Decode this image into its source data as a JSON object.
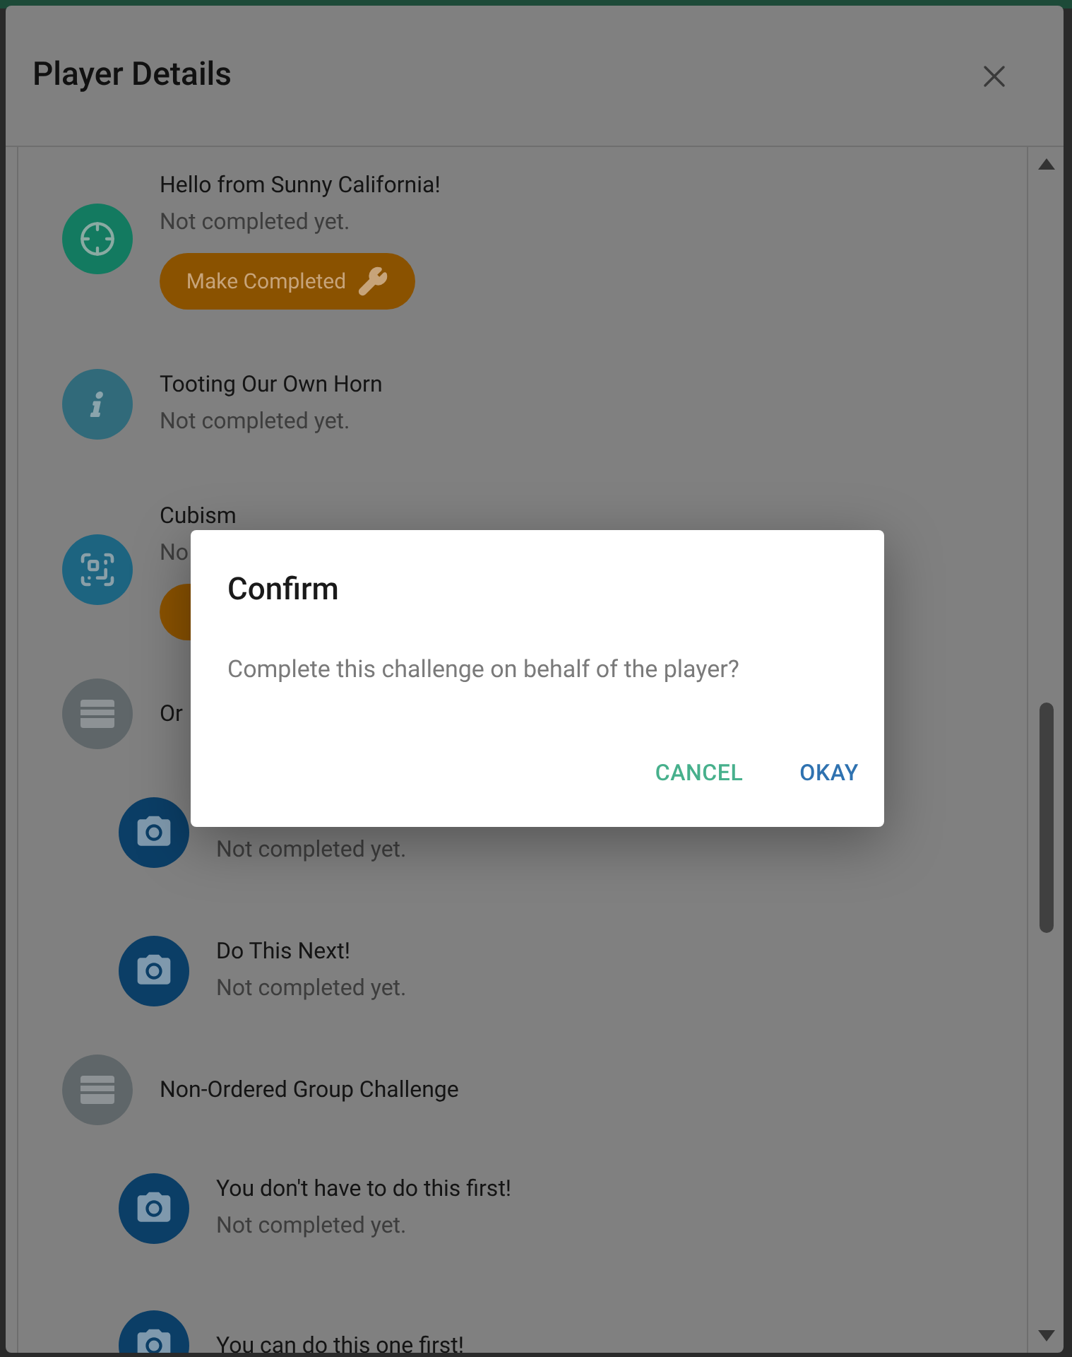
{
  "dialog": {
    "title": "Player Details"
  },
  "challenges": [
    {
      "kind": "gps",
      "title": "Hello from Sunny California!",
      "status": "Not completed yet.",
      "action_button": true,
      "action_label": "Make Completed"
    },
    {
      "kind": "info",
      "title": "Tooting Our Own Horn",
      "status": "Not completed yet.",
      "action_button": false
    },
    {
      "kind": "qr",
      "title": "Cubism",
      "status": "No",
      "action_button": true
    },
    {
      "kind": "group",
      "title": "Or",
      "children": [
        {
          "kind": "photo",
          "status": "Not completed yet.",
          "action_button": false
        },
        {
          "kind": "photo",
          "title": "Do This Next!",
          "status": "Not completed yet.",
          "action_button": false
        }
      ]
    },
    {
      "kind": "group",
      "title": "Non-Ordered Group Challenge",
      "children": [
        {
          "kind": "photo",
          "title": "You don't have to do this first!",
          "status": "Not completed yet.",
          "action_button": false
        },
        {
          "kind": "photo",
          "title": "You can do this one first!",
          "action_button": false
        }
      ]
    }
  ],
  "confirm": {
    "title": "Confirm",
    "message": "Complete this challenge on behalf of the player?",
    "buttons": [
      {
        "kind": "cancel",
        "label": "CANCEL"
      },
      {
        "kind": "ok",
        "label": "OKAY"
      }
    ]
  }
}
